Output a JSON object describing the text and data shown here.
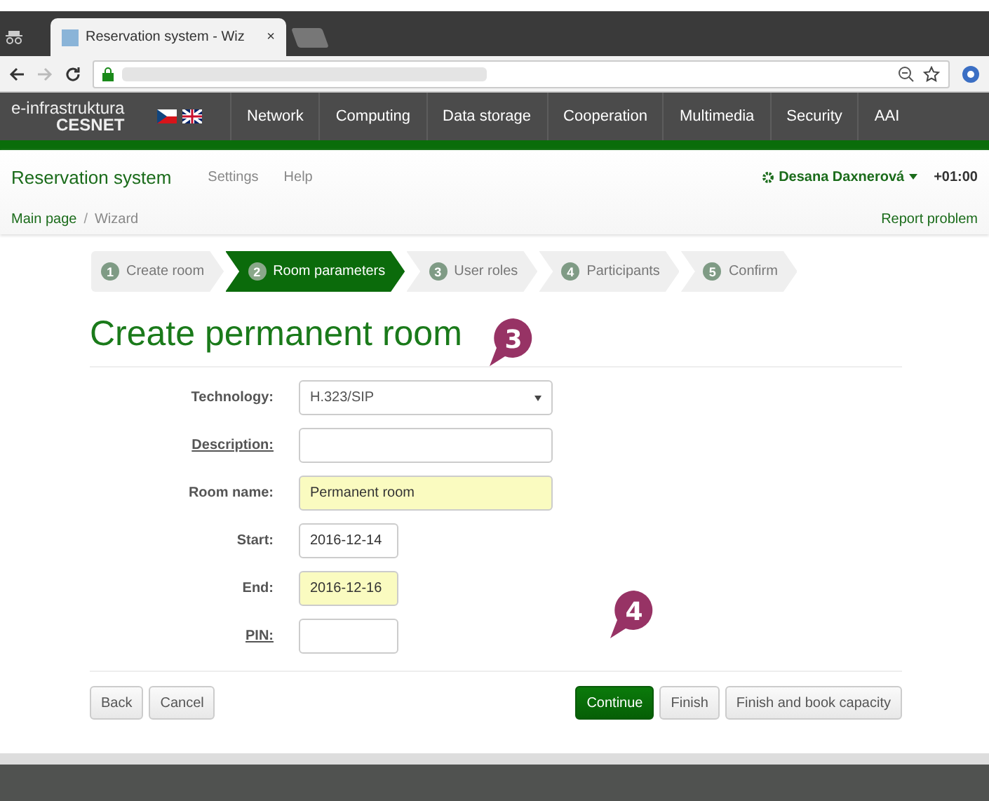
{
  "browser": {
    "tab_title": "Reservation system - Wiz",
    "tab_close": "×"
  },
  "portal": {
    "logo_top": "e-infrastruktura",
    "logo_bottom": "CESNET",
    "menu": [
      "Network",
      "Computing",
      "Data storage",
      "Cooperation",
      "Multimedia",
      "Security",
      "AAI"
    ]
  },
  "app": {
    "title": "Reservation system",
    "links": [
      "Settings",
      "Help"
    ],
    "user": "Desana Daxnerová",
    "timezone": "+01:00"
  },
  "breadcrumb": [
    {
      "label": "Main page",
      "selected": false
    },
    {
      "label": "Wizard",
      "selected": true
    }
  ],
  "breadcrumb_separator": "/",
  "report": "Report problem",
  "steps": [
    {
      "number": "1",
      "label": "Create room",
      "selected": false
    },
    {
      "number": "2",
      "label": "Room parameters",
      "selected": true
    },
    {
      "number": "3",
      "label": "User roles",
      "selected": false
    },
    {
      "number": "4",
      "label": "Participants",
      "selected": false
    },
    {
      "number": "5",
      "label": "Confirm",
      "selected": false
    }
  ],
  "heading": "Create permanent room",
  "fields": [
    {
      "label": "Technology:",
      "kind": "select",
      "value": "H.323/SIP",
      "highlighted": false,
      "underlined": false
    },
    {
      "label": "Description:",
      "kind": "text",
      "highlighted": false,
      "underlined": true
    },
    {
      "label": "Room name:",
      "kind": "text",
      "value": "Permanent room",
      "highlighted": true,
      "underlined": false
    },
    {
      "label": "Start:",
      "kind": "short",
      "value": "2016-12-14",
      "highlighted": false,
      "underlined": false
    },
    {
      "label": "End:",
      "kind": "short",
      "value": "2016-12-16",
      "highlighted": true,
      "underlined": false
    },
    {
      "label": "PIN:",
      "kind": "short",
      "highlighted": false,
      "underlined": true
    }
  ],
  "left_buttons": [
    "Back",
    "Cancel"
  ],
  "right_buttons": [
    {
      "label": "Continue",
      "primary": true
    },
    {
      "label": "Finish",
      "primary": false
    },
    {
      "label": "Finish and book capacity",
      "primary": false
    }
  ],
  "callouts": [
    "3",
    "4"
  ]
}
